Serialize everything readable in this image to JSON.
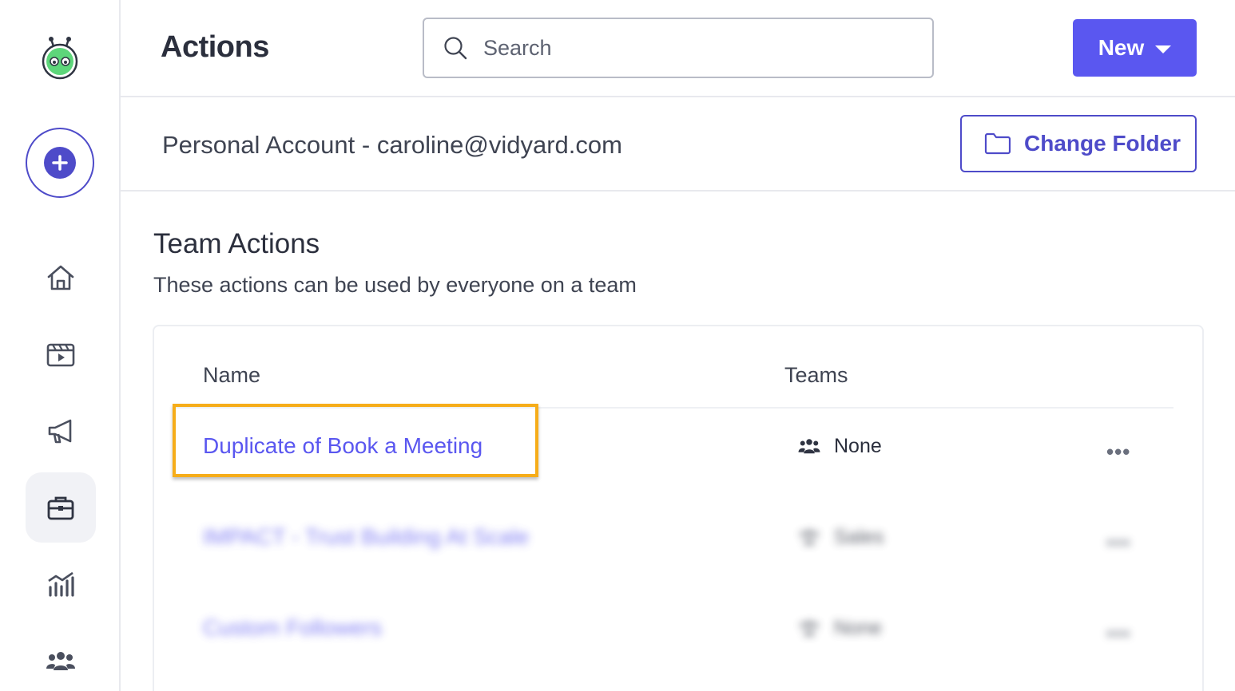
{
  "sidebar": {
    "logo_icon": "robot-logo-icon",
    "create_icon": "plus-icon",
    "items": [
      {
        "icon": "home-icon"
      },
      {
        "icon": "video-library-icon"
      },
      {
        "icon": "megaphone-icon"
      },
      {
        "icon": "briefcase-icon",
        "active": true
      },
      {
        "icon": "analytics-icon"
      },
      {
        "icon": "team-icon"
      }
    ]
  },
  "header": {
    "title": "Actions",
    "search_placeholder": "Search",
    "new_label": "New"
  },
  "subheader": {
    "account": "Personal Account - caroline@vidyard.com",
    "change_folder_label": "Change Folder"
  },
  "section": {
    "title": "Team Actions",
    "description": "These actions can be used by everyone on a team"
  },
  "table": {
    "columns": [
      "Name",
      "Teams"
    ],
    "rows": [
      {
        "name": "Duplicate of Book a Meeting",
        "teams": "None",
        "more": "•••",
        "blurred": false
      },
      {
        "name": "IMPACT - Trust Building At Scale",
        "teams": "Sales",
        "more": "•••",
        "blurred": true
      },
      {
        "name": "Custom Followers",
        "teams": "None",
        "more": "•••",
        "blurred": true
      }
    ]
  },
  "colors": {
    "accent": "#5a57f0",
    "accent_dark": "#4e4bc9",
    "highlight": "#f6ad1a"
  }
}
